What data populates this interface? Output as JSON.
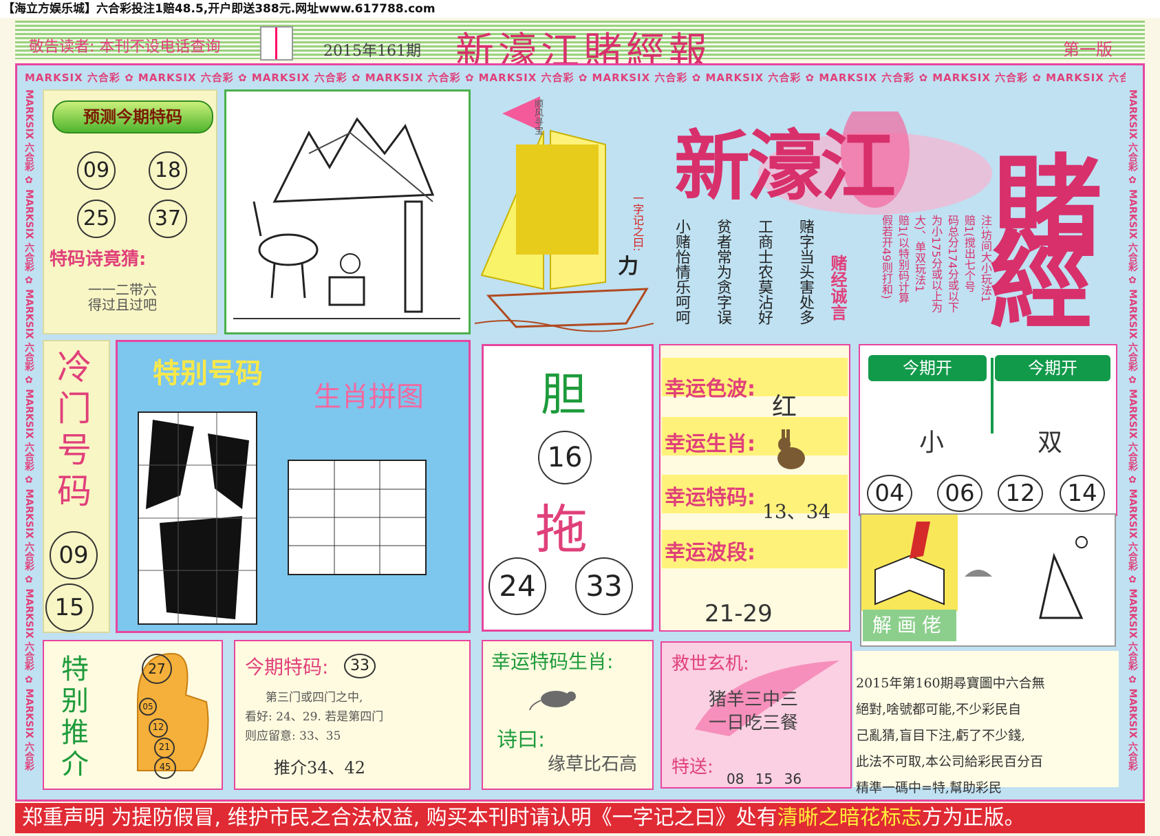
{
  "top_bar": {
    "text": "【海立方娱乐城】六合彩投注1赔48.5,开户即送388元.网址www.617788.com"
  },
  "header": {
    "notice": "敬告读者:  本刊不设电话查询",
    "issue": "2015年161期",
    "title": "新濠江賭經報",
    "edition": "第一版"
  },
  "border_text": "MARKSIX 六合彩",
  "predict": {
    "badge": "预测今期特码",
    "numbers": [
      "09",
      "18",
      "25",
      "37"
    ],
    "poem_title": "特码诗竟猜:",
    "poem": [
      "一一二带六",
      "得过且过吧"
    ]
  },
  "banner": {
    "brand": "新濠江",
    "brand2": "賭",
    "brand3": "經",
    "flag": "顺风寻宝",
    "sail_text": "一字记之曰:",
    "sail_word": "力",
    "motto_title": "赌经诚言",
    "motto_lines": [
      "赌字当头害处多",
      "工商士农莫沾好",
      "贫者常为贪字误",
      "小赌怡情乐呵呵"
    ],
    "note_lines": [
      "注:坊间大小玩法1",
      "赔1(搅出七个号",
      "码总分174分或以下",
      "为小175分或以上为",
      "大)、单双玩法1",
      "赔1(以特别码计算",
      "假若开49则打和)"
    ]
  },
  "cold": {
    "title": "冷门号码",
    "numbers": [
      "09",
      "15"
    ]
  },
  "puzzle": {
    "title": "特别号码",
    "subtitle": "生肖拼图"
  },
  "dan": {
    "dan": "胆",
    "dan_num": "16",
    "tuo": "拖",
    "tuo_nums": [
      "24",
      "33"
    ]
  },
  "lucky": {
    "color_label": "幸运色波:",
    "color_value": "红",
    "zodiac_label": "幸运生肖:",
    "code_label": "幸运特码:",
    "code_value": "13、34",
    "range_label": "幸运波段:",
    "range_value": "21-29"
  },
  "open": {
    "label1": "今期开",
    "label2": "今期开",
    "value1": "小",
    "value2": "双",
    "numbers": [
      "04",
      "06",
      "12",
      "14"
    ]
  },
  "painting": {
    "label": "解画佬"
  },
  "commentary": [
    "2015年第160期尋寶圖中六合無",
    "絕對,啥號都可能,不少彩民自",
    "己亂猜,盲目下注,虧了不少錢,",
    "此法不可取,本公司給彩民百分百",
    "精準一碼中=特,幫助彩民"
  ],
  "special": {
    "title": "特别推介",
    "numbers": [
      "27",
      "05",
      "12",
      "21",
      "45"
    ]
  },
  "this_issue": {
    "label": "今期特码:",
    "number": "33",
    "lines": [
      "第三门或四门之中,",
      "看好: 24、29. 若是第四门",
      "则应留意: 33、35"
    ],
    "recommend": "推介34、42"
  },
  "lucky_zodiac": {
    "title": "幸运特码生肖:",
    "poem_label": "诗曰:",
    "poem": "缘草比石高"
  },
  "oracle": {
    "title": "救世玄机:",
    "lines": [
      "猪羊三中三",
      "一日吃三餐"
    ],
    "send_label": "特送:",
    "send_nums": "08 15 36"
  },
  "footer": {
    "part1": "郑重声明  为提防假冒, 维护市民之合法权益,  购买本刊时请认明《一字记之曰》处有",
    "highlight": "清晰之暗花标志",
    "part2": "方为正版。"
  }
}
